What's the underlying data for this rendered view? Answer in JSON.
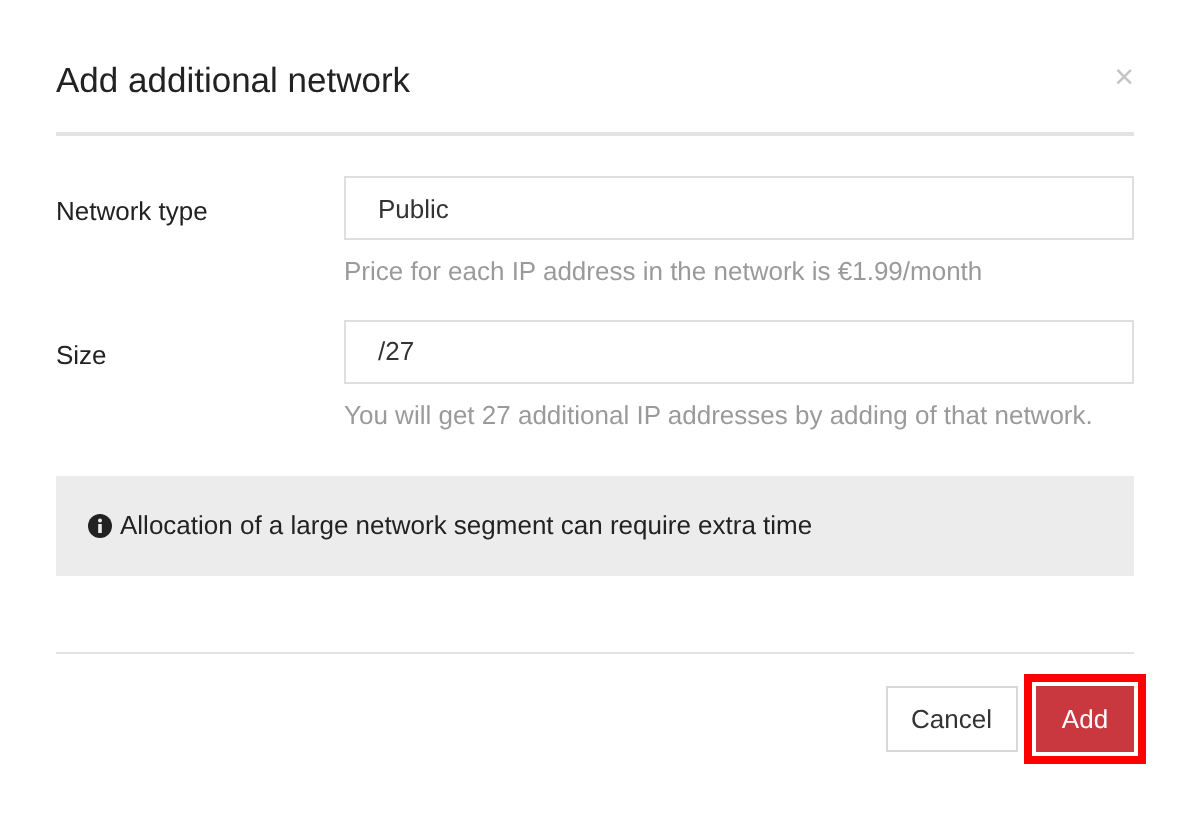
{
  "dialog": {
    "title": "Add additional network",
    "close": "×"
  },
  "fields": [
    {
      "label": "Network type",
      "value": "Public",
      "help": "Price for each IP address in the network is €1.99/month"
    },
    {
      "label": "Size",
      "value": "/27",
      "help": "You will get 27 additional IP addresses by adding of that network."
    }
  ],
  "notice": {
    "text": "Allocation of a large network segment can require extra time"
  },
  "buttons": [
    {
      "label": "Cancel",
      "kind": "secondary",
      "highlighted": false
    },
    {
      "label": "Add",
      "kind": "primary",
      "highlighted": true
    }
  ]
}
